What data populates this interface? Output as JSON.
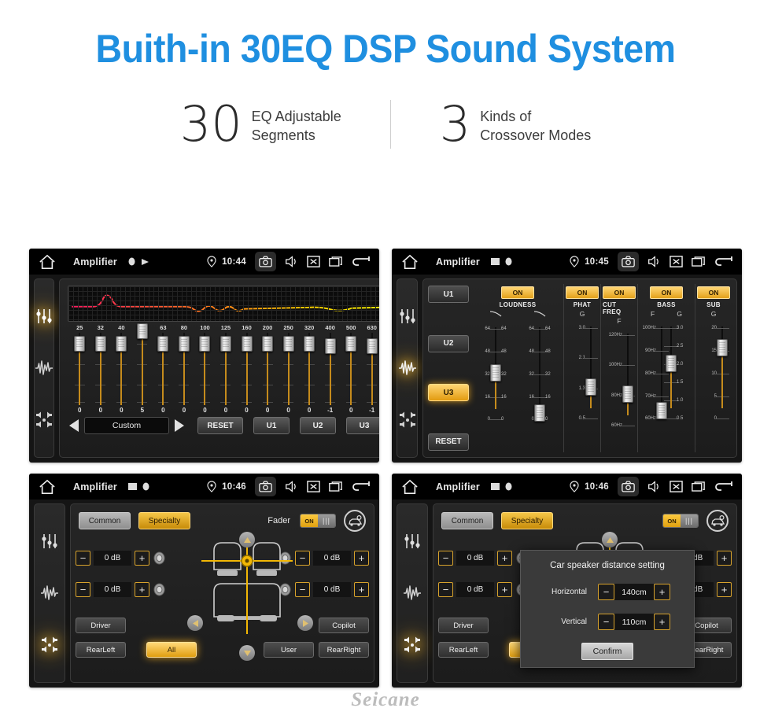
{
  "header": {
    "title": "Buith-in 30EQ DSP Sound System",
    "title_color": "#1f8fe0",
    "stats": [
      {
        "number": "30",
        "line1": "EQ Adjustable",
        "line2": "Segments"
      },
      {
        "number": "3",
        "line1": "Kinds of",
        "line2": "Crossover Modes"
      }
    ]
  },
  "watermark": "Seicane",
  "panels": {
    "eq": {
      "statusbar": {
        "title": "Amplifier",
        "time": "10:44",
        "icons": [
          "home-icon",
          "record-icon",
          "play-icon",
          "location-pin-icon",
          "camera-icon",
          "volume-icon",
          "close-icon",
          "windows-icon",
          "back-arrow-icon"
        ]
      },
      "sidebar": [
        {
          "icon": "equalizer-sliders-icon",
          "active": true
        },
        {
          "icon": "waveform-icon",
          "active": false
        },
        {
          "icon": "speaker-balance-icon",
          "active": false
        }
      ],
      "frequencies": [
        "25",
        "32",
        "40",
        "50",
        "63",
        "80",
        "100",
        "125",
        "160",
        "200",
        "250",
        "320",
        "400",
        "500",
        "630"
      ],
      "values": [
        "0",
        "0",
        "0",
        "5",
        "0",
        "0",
        "0",
        "0",
        "0",
        "0",
        "0",
        "0",
        "-1",
        "0",
        "-1"
      ],
      "more_chevron": "»",
      "preset": "Custom",
      "prev_label": "◀",
      "next_label": "▶",
      "reset_label": "RESET",
      "user_presets": [
        "U1",
        "U2",
        "U3"
      ]
    },
    "crossover": {
      "statusbar": {
        "title": "Amplifier",
        "time": "10:45"
      },
      "sidebar": [
        {
          "icon": "equalizer-sliders-icon",
          "active": false
        },
        {
          "icon": "waveform-icon",
          "active": true
        },
        {
          "icon": "speaker-balance-icon",
          "active": false
        }
      ],
      "user_presets": [
        {
          "label": "U1",
          "active": false
        },
        {
          "label": "U2",
          "active": false
        },
        {
          "label": "U3",
          "active": true
        }
      ],
      "reset_label": "RESET",
      "columns": [
        {
          "name": "LOUDNESS",
          "state": "ON",
          "sliders": [
            {
              "head": "",
              "scale": [
                "64",
                "48",
                "32",
                "16",
                "0"
              ],
              "pos": 50
            },
            {
              "head": "",
              "scale": [
                "64",
                "48",
                "32",
                "16",
                "0"
              ],
              "pos": 95
            }
          ]
        },
        {
          "name": "PHAT",
          "state": "ON",
          "sliders": [
            {
              "head": "G",
              "scale": [
                "3.0",
                "2.1",
                "1.3",
                "0.5"
              ],
              "pos": 66
            }
          ]
        },
        {
          "name": "CUT FREQ",
          "state": "ON",
          "sliders": [
            {
              "head": "F",
              "scale": [
                "120Hz",
                "100Hz",
                "80Hz",
                "60Hz"
              ],
              "pos": 66
            }
          ]
        },
        {
          "name": "BASS",
          "state": "ON",
          "sliders": [
            {
              "head": "F",
              "scale": [
                "100Hz",
                "90Hz",
                "80Hz",
                "70Hz",
                "60Hz"
              ],
              "pos": 93
            },
            {
              "head": "G",
              "scale": [
                "3.0",
                "2.5",
                "2.0",
                "1.5",
                "1.0",
                "0.5"
              ],
              "pos": 40
            }
          ]
        },
        {
          "name": "SUB",
          "state": "ON",
          "sliders": [
            {
              "head": "G",
              "scale": [
                "20",
                "15",
                "10",
                "5",
                "0"
              ],
              "pos": 22
            }
          ]
        }
      ]
    },
    "fader": {
      "statusbar": {
        "title": "Amplifier",
        "time": "10:46"
      },
      "sidebar": [
        {
          "icon": "equalizer-sliders-icon",
          "active": false
        },
        {
          "icon": "waveform-icon",
          "active": false
        },
        {
          "icon": "speaker-balance-icon",
          "active": true
        }
      ],
      "tabs": [
        {
          "label": "Common",
          "active": false
        },
        {
          "label": "Specialty",
          "active": true
        }
      ],
      "fader_label": "Fader",
      "fader_toggle": "ON",
      "car_settings_icon": "car-settings-icon",
      "steppers": [
        {
          "pos": "top-left",
          "value": "0 dB",
          "minus": "−",
          "plus": "+"
        },
        {
          "pos": "top-right",
          "value": "0 dB",
          "minus": "−",
          "plus": "+"
        },
        {
          "pos": "bottom-left",
          "value": "0 dB",
          "minus": "−",
          "plus": "+"
        },
        {
          "pos": "bottom-right",
          "value": "0 dB",
          "minus": "−",
          "plus": "+"
        }
      ],
      "seat_buttons": [
        {
          "label": "Driver",
          "active": false
        },
        {
          "label": "Copilot",
          "active": false
        },
        {
          "label": "RearLeft",
          "active": false
        },
        {
          "label": "All",
          "active": true
        },
        {
          "label": "User",
          "active": false
        },
        {
          "label": "RearRight",
          "active": false
        }
      ]
    },
    "distance": {
      "statusbar": {
        "title": "Amplifier",
        "time": "10:46"
      },
      "modal": {
        "title": "Car speaker distance setting",
        "rows": [
          {
            "label": "Horizontal",
            "value": "140cm",
            "minus": "−",
            "plus": "+"
          },
          {
            "label": "Vertical",
            "value": "110cm",
            "minus": "−",
            "plus": "+"
          }
        ],
        "confirm": "Confirm"
      }
    }
  },
  "colors": {
    "accent_amber": "#e3a11a",
    "accent_blue": "#1f8fe0",
    "panel_bg": "#1c1c1c"
  }
}
